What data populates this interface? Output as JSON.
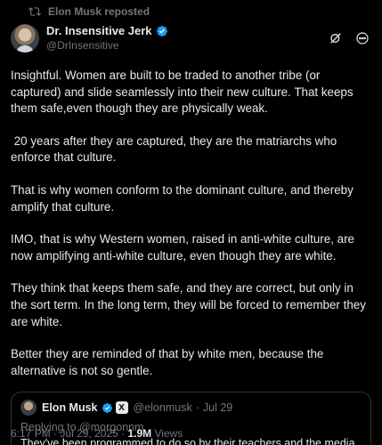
{
  "repost": {
    "label": "Elon Musk reposted",
    "icon": "repost-icon"
  },
  "author": {
    "display_name": "Dr. Insensitive Jerk",
    "handle": "@DrInsensitive",
    "verified_color": "#1d9bf0"
  },
  "header_icons": [
    "grok-icon",
    "more-options-icon"
  ],
  "body": {
    "paragraphs": [
      "Insightful. Women are built to be traded to another tribe (or captured) and slide seamlessly into their new culture. That keeps them safe,even though they are physically weak.",
      " 20 years after they are captured, they are the matriarchs who enforce that culture.",
      "That is why women conform to the dominant culture, and thereby amplify that culture.",
      "IMO, that is why Western women, raised in anti-white culture, are now amplifying anti-white culture, even though they are white.",
      "They think that keeps them safe, and they are correct, but only in the sort term. In the long term, they will be forced to remember they are white.",
      "Better they are reminded of that by white men, because the alternative is not so gentle."
    ]
  },
  "quote": {
    "name": "Elon Musk",
    "affiliate_badge": "X",
    "handle": "@elonmusk",
    "separator": "·",
    "date": "Jul 29",
    "reply_prefix": "Replying to",
    "reply_to": "@morgonnm",
    "text": "They've been programmed to do so by their teachers and the media"
  },
  "meta": {
    "time": "6:17 PM",
    "separator": "·",
    "date": "Jul 29, 2025",
    "views_count": "1.9M",
    "views_label": "Views"
  }
}
